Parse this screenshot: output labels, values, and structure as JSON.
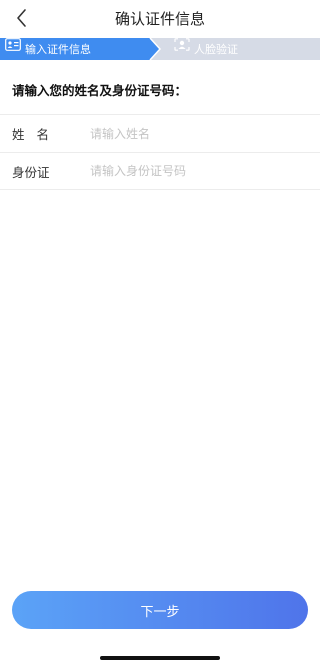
{
  "header": {
    "title": "确认证件信息",
    "back_icon": "chevron-left-icon"
  },
  "steps": [
    {
      "label": "输入证件信息",
      "icon": "id-card-icon",
      "active": true
    },
    {
      "label": "人脸验证",
      "icon": "face-scan-icon",
      "active": false
    }
  ],
  "prompt": "请输入您的姓名及身份证号码：",
  "form": {
    "name_label": "姓名",
    "name_placeholder": "请输入姓名",
    "id_label": "身份证",
    "id_placeholder": "请输入身份证号码"
  },
  "next_button": "下一步",
  "colors": {
    "step_active": "#3f8cf0",
    "step_inactive": "#d6dbe6",
    "button_start": "#5ba3f7",
    "button_end": "#4f74ea"
  }
}
